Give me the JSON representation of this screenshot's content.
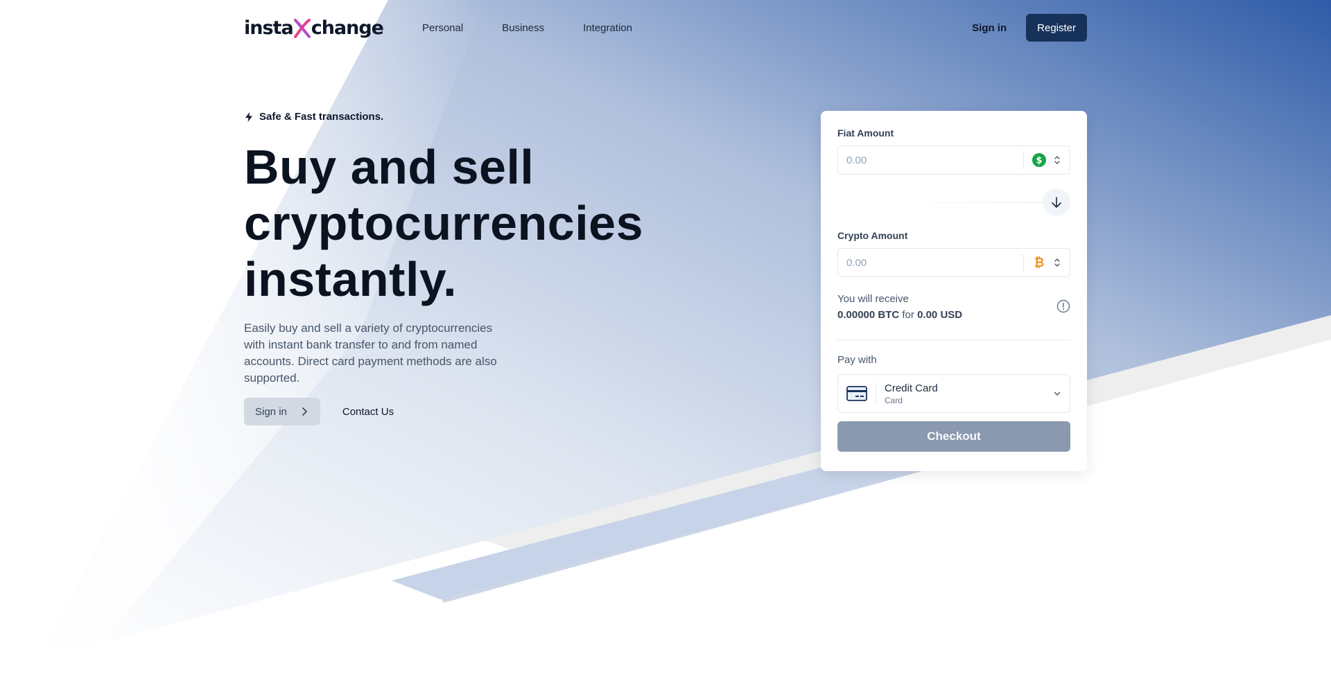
{
  "brand": {
    "logo_left": "insta",
    "logo_right": "change",
    "navy": "#17325a",
    "accent_pink": "#e83e8c",
    "accent_purple": "#8b5cf6"
  },
  "nav": {
    "items": [
      {
        "label": "Personal"
      },
      {
        "label": "Business"
      },
      {
        "label": "Integration"
      }
    ],
    "sign_in": "Sign in",
    "register": "Register"
  },
  "hero": {
    "tagline": "Safe & Fast transactions.",
    "headline_1": "Buy and sell",
    "headline_2": "cryptocurrencies",
    "headline_3": "instantly.",
    "description": "Easily buy and sell a variety of cryptocurrencies with instant bank transfer to and from named accounts. Direct card payment methods are also supported.",
    "sign_in_button": "Sign in",
    "contact_link": "Contact Us"
  },
  "exchange_card": {
    "fiat_label": "Fiat Amount",
    "fiat_placeholder": "0.00",
    "fiat_currency_icon": "dollar-icon",
    "crypto_label": "Crypto Amount",
    "crypto_placeholder": "0.00",
    "crypto_currency_icon": "bitcoin-icon",
    "receive_label": "You will receive",
    "receive_crypto": "0.00000 BTC",
    "receive_for": "for",
    "receive_fiat": "0.00 USD",
    "pay_with_label": "Pay with",
    "payment_method": "Credit Card",
    "payment_method_sub": "Card",
    "checkout": "Checkout"
  }
}
